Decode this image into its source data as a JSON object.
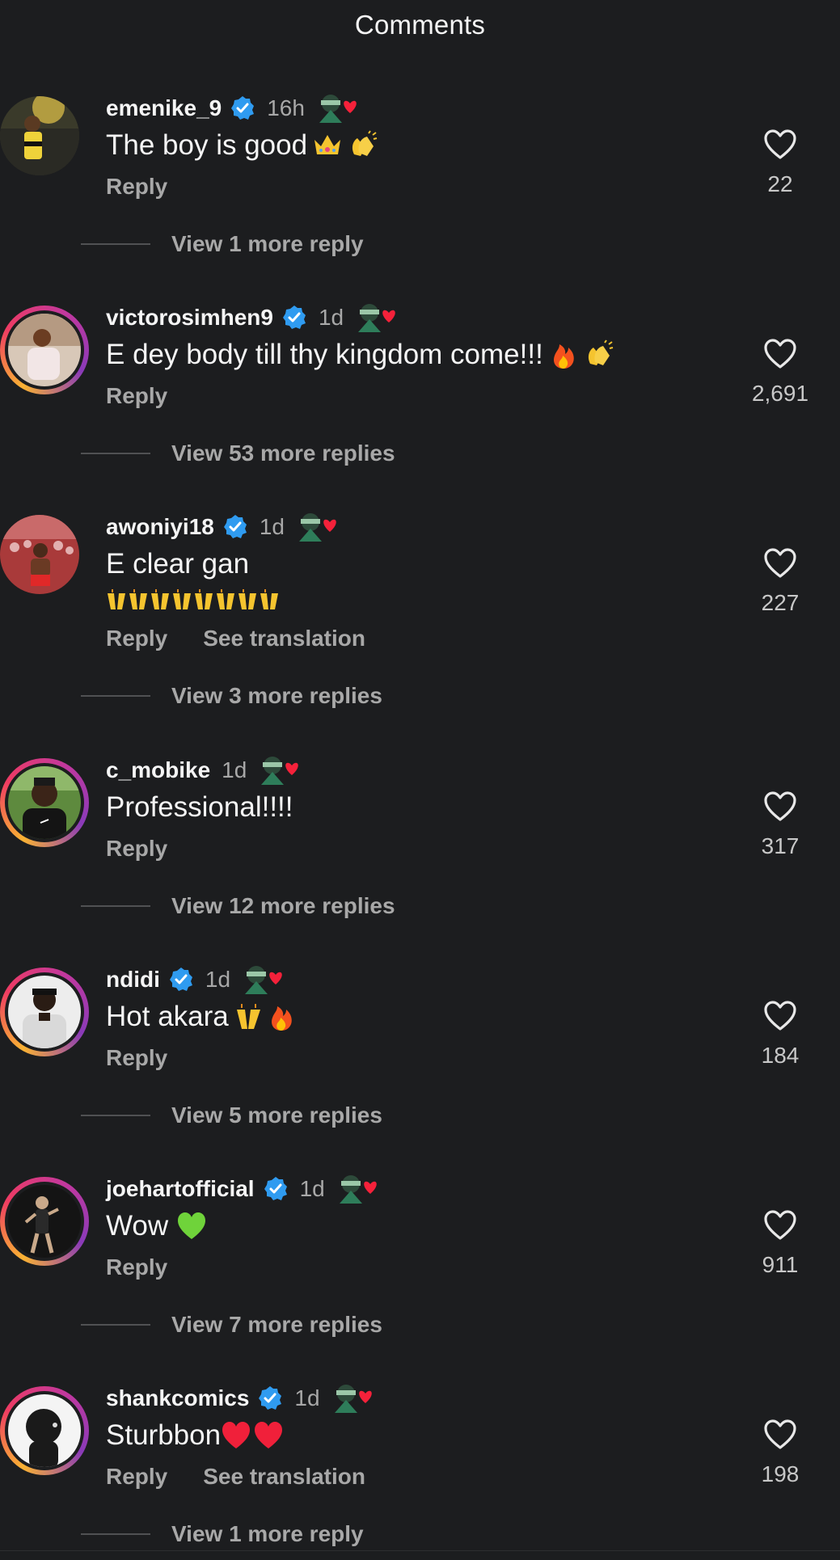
{
  "header": {
    "title": "Comments"
  },
  "comments": [
    {
      "username": "emenike_9",
      "verified": true,
      "time": "16h",
      "text": "The boy is good",
      "emojis": [
        "crown",
        "clap"
      ],
      "likes": "22",
      "reply_label": "Reply",
      "view_more": "View 1 more reply",
      "ring": false
    },
    {
      "username": "victorosimhen9",
      "verified": true,
      "time": "1d",
      "text": "E dey body till thy kingdom come!!!",
      "emojis": [
        "fire",
        "clap"
      ],
      "likes": "2,691",
      "reply_label": "Reply",
      "view_more": "View 53 more replies",
      "ring": true
    },
    {
      "username": "awoniyi18",
      "verified": true,
      "time": "1d",
      "text": "E clear gan",
      "emoji_line": "raising-hands x8",
      "likes": "227",
      "reply_label": "Reply",
      "translate_label": "See translation",
      "view_more": "View 3 more replies",
      "ring": false
    },
    {
      "username": "c_mobike",
      "verified": false,
      "time": "1d",
      "text": "Professional!!!!",
      "likes": "317",
      "reply_label": "Reply",
      "view_more": "View 12 more replies",
      "ring": true
    },
    {
      "username": "ndidi",
      "verified": true,
      "time": "1d",
      "text": "Hot akara",
      "emojis": [
        "raising-hands",
        "fire"
      ],
      "likes": "184",
      "reply_label": "Reply",
      "view_more": "View 5 more replies",
      "ring": true
    },
    {
      "username": "joehartofficial",
      "verified": true,
      "time": "1d",
      "text": "Wow",
      "emojis": [
        "green-heart"
      ],
      "likes": "911",
      "reply_label": "Reply",
      "view_more": "View 7 more replies",
      "ring": true
    },
    {
      "username": "shankcomics",
      "verified": true,
      "time": "1d",
      "text": "Sturbbon",
      "emojis": [
        "red-heart",
        "red-heart"
      ],
      "likes": "198",
      "reply_label": "Reply",
      "translate_label": "See translation",
      "view_more": "View 1 more reply",
      "ring": true
    }
  ],
  "icons": {
    "verified": "verified-badge-icon",
    "like": "heart-outline-icon",
    "sticker": "avatar-sticker-with-heart-icon"
  },
  "colors": {
    "background": "#1c1d1f",
    "text": "#f5f5f5",
    "secondary_text": "#a8a8a8",
    "verified_blue": "#2f9bf0",
    "story_ring_gradient": [
      "#f9b233",
      "#ee3b63",
      "#c1389e",
      "#8a3ab9"
    ]
  }
}
